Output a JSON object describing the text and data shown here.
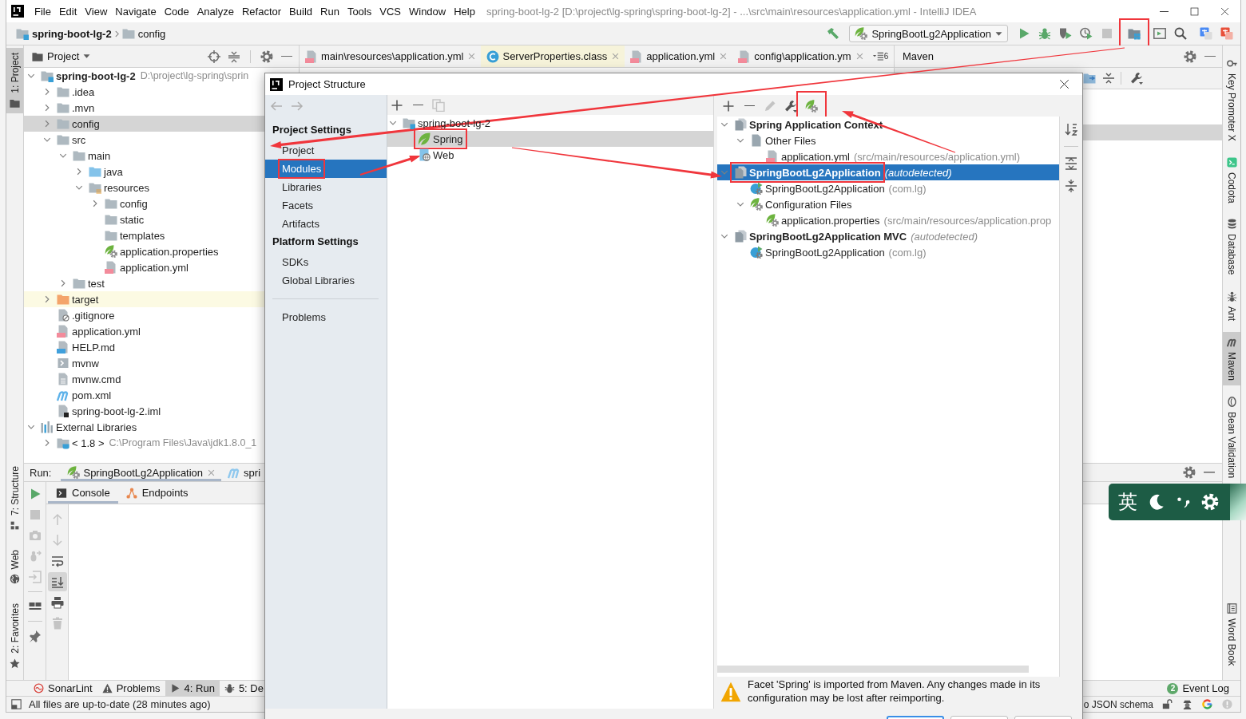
{
  "window": {
    "title": "spring-boot-lg-2 [D:\\project\\lg-spring\\spring-boot-lg-2] - ...\\src\\main\\resources\\application.yml - IntelliJ IDEA"
  },
  "menu": [
    "File",
    "Edit",
    "View",
    "Navigate",
    "Code",
    "Analyze",
    "Refactor",
    "Build",
    "Run",
    "Tools",
    "VCS",
    "Window",
    "Help"
  ],
  "navbar": {
    "breadcrumbs": [
      {
        "kind": "module",
        "label": "spring-boot-lg-2"
      },
      {
        "kind": "folder",
        "label": "config"
      }
    ],
    "run_configuration": "SpringBootLg2Application",
    "actions": [
      {
        "kind": "run",
        "disabled": false,
        "highlighted": false
      },
      {
        "kind": "debug",
        "disabled": false,
        "highlighted": false
      },
      {
        "kind": "coverage",
        "disabled": false,
        "highlighted": false
      },
      {
        "kind": "profile",
        "disabled": false,
        "highlighted": false
      },
      {
        "kind": "stop",
        "disabled": true,
        "highlighted": false
      },
      {
        "kind": "project-structure",
        "disabled": false,
        "highlighted": true
      },
      {
        "kind": "run-dashboard",
        "disabled": false,
        "highlighted": false
      },
      {
        "kind": "search",
        "disabled": false,
        "highlighted": false
      },
      {
        "kind": "translate",
        "disabled": false,
        "highlighted": false
      },
      {
        "kind": "translate-alt",
        "disabled": false,
        "highlighted": false
      }
    ]
  },
  "left_stripe": {
    "top": [
      {
        "label": "1: Project",
        "kind": "project",
        "selected": true
      }
    ],
    "bottom": [
      {
        "label": "7: Structure",
        "kind": "structure",
        "selected": false
      },
      {
        "label": "Web",
        "kind": "web",
        "selected": false
      },
      {
        "label": "2: Favorites",
        "kind": "favorites",
        "selected": false
      }
    ]
  },
  "project_panel": {
    "title": "Project",
    "tree": [
      {
        "label": "spring-boot-lg-2",
        "path": "D:\\project\\lg-spring\\sprin",
        "kind": "module",
        "expanded": true,
        "selected": false,
        "children": [
          {
            "label": ".idea",
            "kind": "folder",
            "expanded": false,
            "selected": false
          },
          {
            "label": ".mvn",
            "kind": "folder",
            "expanded": false,
            "selected": false
          },
          {
            "label": "config",
            "kind": "folder",
            "expanded": false,
            "selected": true
          },
          {
            "label": "src",
            "kind": "folder",
            "expanded": true,
            "selected": false,
            "children": [
              {
                "label": "main",
                "kind": "folder",
                "expanded": true,
                "selected": false,
                "children": [
                  {
                    "label": "java",
                    "kind": "source-folder",
                    "expanded": false,
                    "selected": false
                  },
                  {
                    "label": "resources",
                    "kind": "resources-folder",
                    "expanded": true,
                    "selected": false,
                    "children": [
                      {
                        "label": "config",
                        "kind": "folder",
                        "expanded": false,
                        "selected": false
                      },
                      {
                        "label": "static",
                        "kind": "folder",
                        "selected": false
                      },
                      {
                        "label": "templates",
                        "kind": "folder",
                        "selected": false
                      },
                      {
                        "label": "application.properties",
                        "kind": "spring-config",
                        "selected": false
                      },
                      {
                        "label": "application.yml",
                        "kind": "yml",
                        "selected": false
                      }
                    ]
                  }
                ]
              },
              {
                "label": "test",
                "kind": "folder",
                "expanded": false,
                "selected": false
              }
            ]
          },
          {
            "label": "target",
            "kind": "excluded-folder",
            "expanded": false,
            "selected": false
          },
          {
            "label": ".gitignore",
            "kind": "gitignore",
            "selected": false
          },
          {
            "label": "application.yml",
            "kind": "yml",
            "selected": false
          },
          {
            "label": "HELP.md",
            "kind": "markdown",
            "selected": false
          },
          {
            "label": "mvnw",
            "kind": "script",
            "selected": false
          },
          {
            "label": "mvnw.cmd",
            "kind": "text-file",
            "selected": false
          },
          {
            "label": "pom.xml",
            "kind": "pom",
            "selected": false
          },
          {
            "label": "spring-boot-lg-2.iml",
            "kind": "iml",
            "selected": false
          }
        ]
      },
      {
        "label": "External Libraries",
        "kind": "libraries",
        "expanded": true,
        "selected": false,
        "children": [
          {
            "label": "< 1.8 >",
            "path": "C:\\Program Files\\Java\\jdk1.8.0_1",
            "kind": "jdk",
            "expanded": false,
            "selected": false
          }
        ]
      }
    ]
  },
  "editor": {
    "tabs": [
      {
        "label": "main\\resources\\application.yml",
        "kind": "yml",
        "color": "#f2f2f2"
      },
      {
        "label": "ServerProperties.class",
        "kind": "class",
        "color": "#f6f3da"
      },
      {
        "label": "application.yml",
        "kind": "yml",
        "color": "#f2f2f2"
      },
      {
        "label": "config\\application.ym",
        "kind": "yml",
        "color": "#f2f2f2"
      }
    ],
    "more_tabs": "6"
  },
  "maven_panel": {
    "title": "Maven"
  },
  "right_stripe": {
    "top": [
      {
        "label": "Key Promoter X",
        "kind": "key-promoter",
        "selected": false
      },
      {
        "label": "Codota",
        "kind": "codota",
        "selected": false
      },
      {
        "label": "Database",
        "kind": "database",
        "selected": false
      },
      {
        "label": "Ant",
        "kind": "ant",
        "selected": false
      },
      {
        "label": "Maven",
        "kind": "maven",
        "selected": true
      },
      {
        "label": "Bean Validation",
        "kind": "bean-validation",
        "selected": false
      }
    ],
    "bottom": [
      {
        "label": "Word Book",
        "kind": "word-book",
        "selected": false
      }
    ]
  },
  "run_panel": {
    "label": "Run:",
    "tabs": [
      {
        "label": "SpringBootLg2Application",
        "kind": "spring-boot",
        "selected": true
      },
      {
        "label": "spri",
        "kind": "maven",
        "selected": false
      }
    ],
    "actions": [
      {
        "kind": "rerun",
        "disabled": false
      },
      {
        "kind": "stop",
        "disabled": true
      },
      {
        "kind": "screenshot",
        "disabled": true
      },
      {
        "kind": "dump-threads",
        "disabled": true
      },
      {
        "kind": "exit",
        "disabled": true
      },
      {
        "kind": "separator"
      },
      {
        "kind": "layout",
        "disabled": false
      },
      {
        "kind": "separator"
      },
      {
        "kind": "pin",
        "disabled": false
      }
    ],
    "views": [
      {
        "label": "Console",
        "kind": "console",
        "selected": true
      },
      {
        "label": "Endpoints",
        "kind": "endpoints",
        "selected": false
      }
    ],
    "console_actions": [
      {
        "kind": "up",
        "disabled": true,
        "on": false
      },
      {
        "kind": "down",
        "disabled": true,
        "on": false
      },
      {
        "kind": "soft-wrap",
        "disabled": false,
        "on": false
      },
      {
        "kind": "scroll-to-end",
        "disabled": false,
        "on": true
      },
      {
        "kind": "print",
        "disabled": false,
        "on": false
      },
      {
        "kind": "clear",
        "disabled": true,
        "on": false
      }
    ]
  },
  "tool_windows": [
    {
      "label": "SonarLint",
      "kind": "sonarlint",
      "selected": false
    },
    {
      "label": "Problems",
      "kind": "problems",
      "selected": false
    },
    {
      "label": "4: Run",
      "kind": "run",
      "selected": true
    },
    {
      "label": "5: De",
      "kind": "debug",
      "selected": false
    }
  ],
  "event_log": {
    "label": "Event Log",
    "count": "2"
  },
  "status_bar": {
    "message": "All files are up-to-date (28 minutes ago)",
    "json_schema": "o JSON schema"
  },
  "dialog": {
    "title": "Project Structure",
    "nav": [
      {
        "kind": "heading",
        "label": "Project Settings"
      },
      {
        "kind": "item",
        "label": "Project",
        "selected": false,
        "highlighted": false
      },
      {
        "kind": "item",
        "label": "Modules",
        "selected": true,
        "highlighted": true
      },
      {
        "kind": "item",
        "label": "Libraries",
        "selected": false,
        "highlighted": false
      },
      {
        "kind": "item",
        "label": "Facets",
        "selected": false,
        "highlighted": false
      },
      {
        "kind": "item",
        "label": "Artifacts",
        "selected": false,
        "highlighted": false
      },
      {
        "kind": "heading",
        "label": "Platform Settings"
      },
      {
        "kind": "item",
        "label": "SDKs",
        "selected": false,
        "highlighted": false
      },
      {
        "kind": "item",
        "label": "Global Libraries",
        "selected": false,
        "highlighted": false
      },
      {
        "kind": "separator"
      },
      {
        "kind": "item",
        "label": "Problems",
        "selected": false,
        "highlighted": false
      }
    ],
    "module_actions": [
      {
        "kind": "add",
        "disabled": false
      },
      {
        "kind": "remove",
        "disabled": false
      },
      {
        "kind": "copy",
        "disabled": true
      }
    ],
    "modules": [
      {
        "label": "spring-boot-lg-2",
        "kind": "module",
        "expanded": true,
        "selected": false,
        "highlighted": false,
        "children": [
          {
            "label": "Spring",
            "kind": "spring",
            "selected": true,
            "highlighted": true
          },
          {
            "label": "Web",
            "kind": "web",
            "selected": false,
            "highlighted": false
          }
        ]
      }
    ],
    "facet_actions": [
      {
        "kind": "add",
        "disabled": false,
        "highlighted": false
      },
      {
        "kind": "remove",
        "disabled": false,
        "highlighted": false
      },
      {
        "kind": "edit",
        "disabled": true,
        "highlighted": false
      },
      {
        "kind": "settings",
        "disabled": false,
        "highlighted": false
      },
      {
        "kind": "spring-facet",
        "disabled": false,
        "highlighted": true
      }
    ],
    "contexts": [
      {
        "label": "Spring Application Context",
        "kind": "context",
        "expanded": true,
        "selected": false,
        "highlighted": false,
        "children": [
          {
            "label": "Other Files",
            "kind": "file-group",
            "expanded": true,
            "selected": false,
            "highlighted": false,
            "children": [
              {
                "label": "application.yml",
                "detail": "(src/main/resources/application.yml)",
                "kind": "yml",
                "selected": false,
                "highlighted": false
              }
            ]
          }
        ]
      },
      {
        "label": "SpringBootLg2Application",
        "note": "(autodetected)",
        "kind": "context",
        "expanded": true,
        "selected": true,
        "highlighted": true,
        "children": [
          {
            "label": "SpringBootLg2Application",
            "detail": "(com.lg)",
            "kind": "boot-class",
            "selected": false,
            "highlighted": false
          },
          {
            "label": "Configuration Files",
            "kind": "config-group",
            "expanded": true,
            "selected": false,
            "highlighted": false,
            "children": [
              {
                "label": "application.properties",
                "detail": "(src/main/resources/application.prop",
                "kind": "spring-config",
                "selected": false,
                "highlighted": false
              }
            ]
          }
        ]
      },
      {
        "label": "SpringBootLg2Application MVC",
        "note": "(autodetected)",
        "kind": "context",
        "expanded": true,
        "selected": false,
        "highlighted": false,
        "children": [
          {
            "label": "SpringBootLg2Application",
            "detail": "(com.lg)",
            "kind": "boot-class",
            "selected": false,
            "highlighted": false
          }
        ]
      }
    ],
    "warning": "Facet 'Spring' is imported from Maven. Any changes made in its configuration may be lost after reimporting.",
    "buttons": [
      {
        "default": true
      },
      {
        "default": false
      },
      {
        "default": false
      }
    ]
  },
  "input_method": {
    "mode": "英"
  }
}
